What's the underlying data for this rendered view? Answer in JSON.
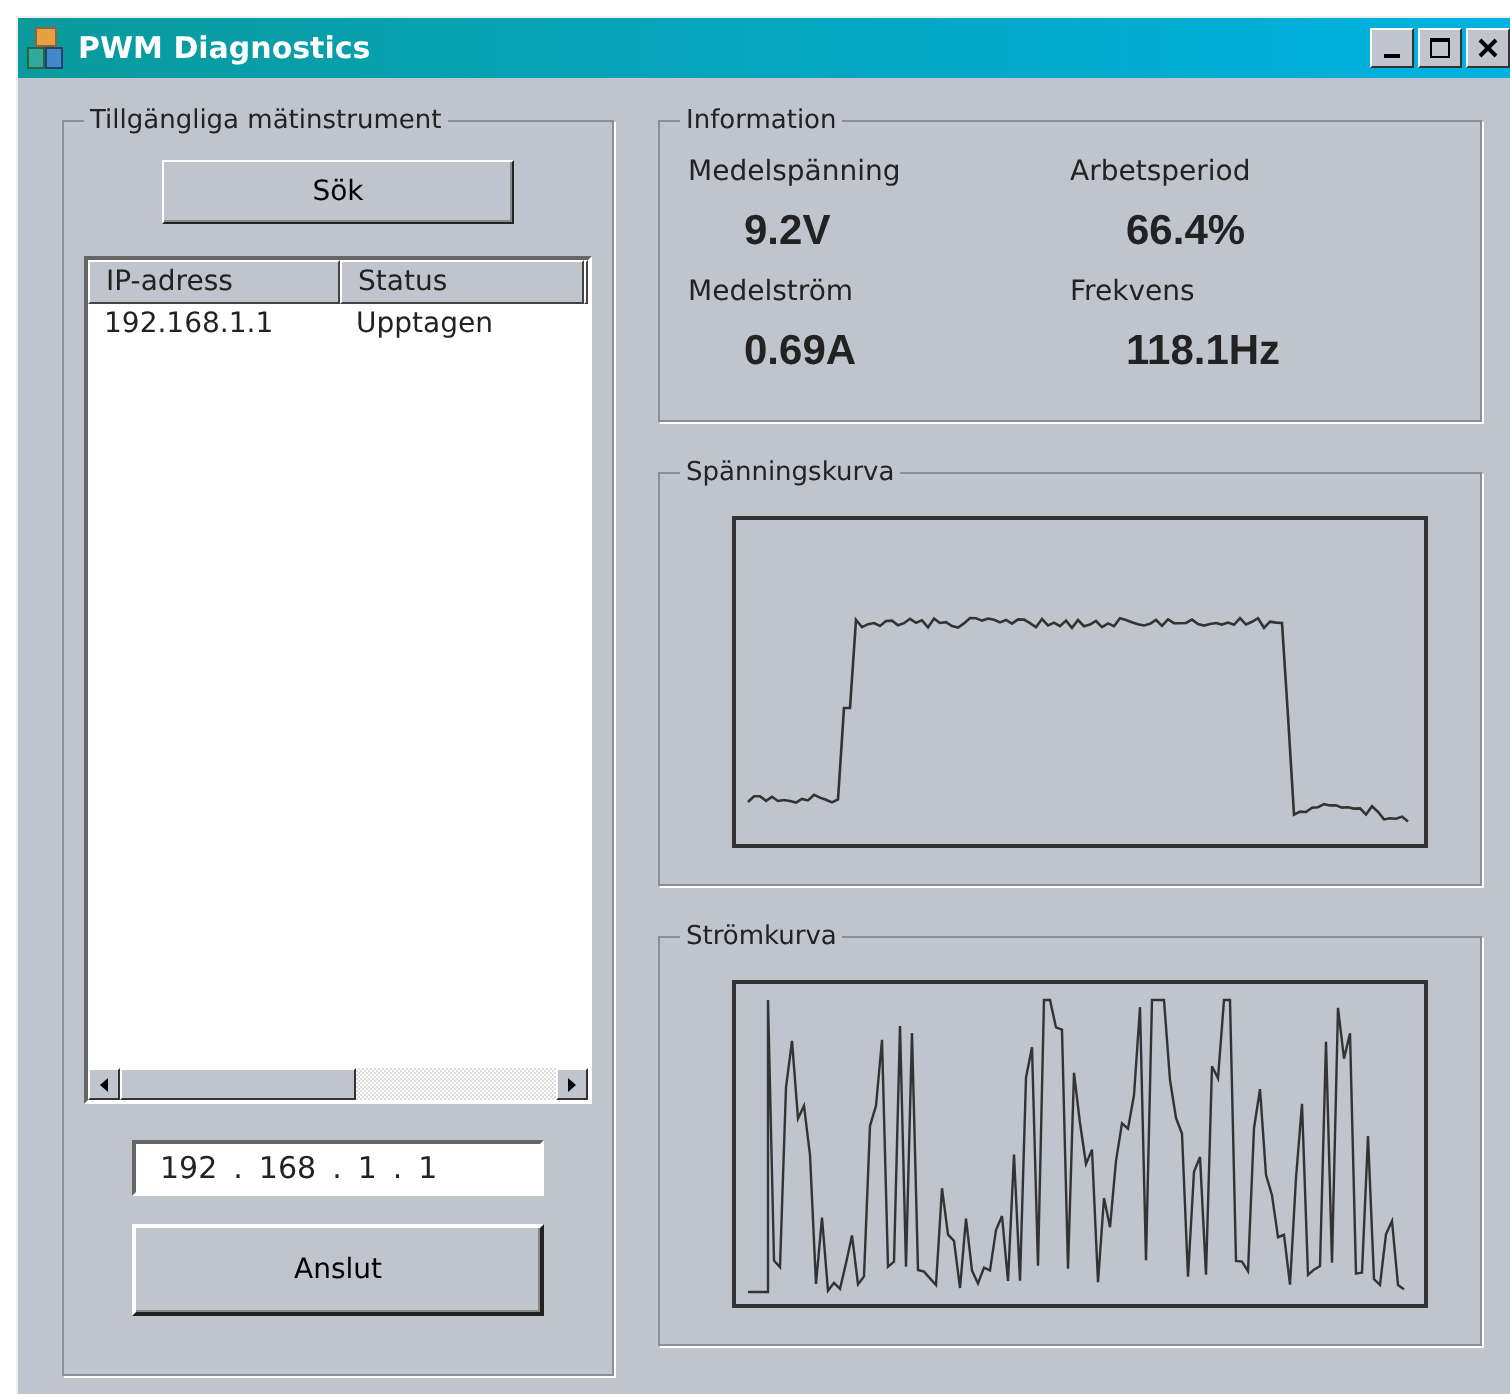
{
  "window": {
    "title": "PWM Diagnostics"
  },
  "instruments": {
    "title": "Tillgängliga mätinstrument",
    "search_button": "Sök",
    "table": {
      "columns": [
        "IP-adress",
        "Status"
      ],
      "rows": [
        {
          "cells": [
            "192.168.1.1",
            "Upptagen"
          ]
        }
      ]
    },
    "ip_field": {
      "value": [
        "192",
        ".",
        "168",
        ".",
        "1",
        ".",
        "1"
      ]
    },
    "connect_button": "Anslut"
  },
  "information": {
    "title": "Information",
    "items": [
      {
        "label": "Medelspänning",
        "value": "9.2V"
      },
      {
        "label": "Arbetsperiod",
        "value": "66.4%"
      },
      {
        "label": "Medelström",
        "value": "0.69A"
      },
      {
        "label": "Frekvens",
        "value": "118.1Hz"
      }
    ]
  },
  "voltage_panel": {
    "title": "Spänningskurva"
  },
  "current_panel": {
    "title": "Strömkurva"
  }
}
